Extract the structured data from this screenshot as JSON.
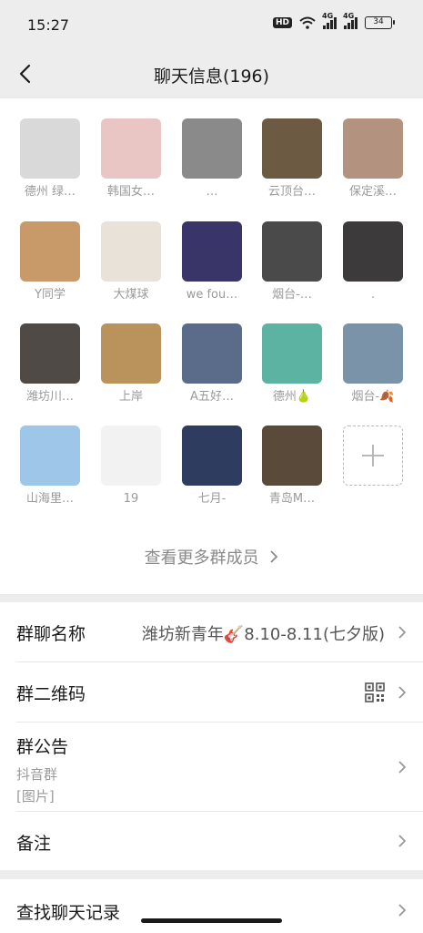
{
  "status": {
    "time": "15:27",
    "hd": "HD",
    "battery": "34",
    "sig1": "4G",
    "sig2": "4G"
  },
  "nav": {
    "title": "聊天信息(196)"
  },
  "members": [
    {
      "name": "德州 绿…",
      "bg": "#d9d9d9"
    },
    {
      "name": "韩国女…",
      "bg": "#e9c6c3"
    },
    {
      "name": "…",
      "bg": "#8a8a8a"
    },
    {
      "name": "云顶台…",
      "bg": "#6d5a42"
    },
    {
      "name": "保定溪…",
      "bg": "#b49280"
    },
    {
      "name": "Y同学",
      "bg": "#c89a6a"
    },
    {
      "name": "大煤球",
      "bg": "#e8e2d8"
    },
    {
      "name": "we fou…",
      "bg": "#3a3568"
    },
    {
      "name": "烟台-…",
      "bg": "#4a4a4a"
    },
    {
      "name": ".",
      "bg": "#3c3a3a"
    },
    {
      "name": "潍坊川…",
      "bg": "#4f4a45"
    },
    {
      "name": "上岸",
      "bg": "#b9925c"
    },
    {
      "name": "A五好…",
      "bg": "#5a6c8a"
    },
    {
      "name": "德州🍐",
      "bg": "#5db3a2"
    },
    {
      "name": "烟台-🍂",
      "bg": "#7a93a8"
    },
    {
      "name": "山海里…",
      "bg": "#9ec6e8"
    },
    {
      "name": "19",
      "bg": "#f2f2f2"
    },
    {
      "name": "七月-",
      "bg": "#2e3c60"
    },
    {
      "name": "青岛M…",
      "bg": "#5a4a3a"
    }
  ],
  "more_members": "查看更多群成员",
  "settings": {
    "group_name_label": "群聊名称",
    "group_name_value": "潍坊新青年🎸8.10-8.11(七夕版)",
    "qr_label": "群二维码",
    "notice_label": "群公告",
    "notice_line1": "抖音群",
    "notice_line2": "[图片]",
    "remark_label": "备注",
    "search_label": "查找聊天记录"
  }
}
